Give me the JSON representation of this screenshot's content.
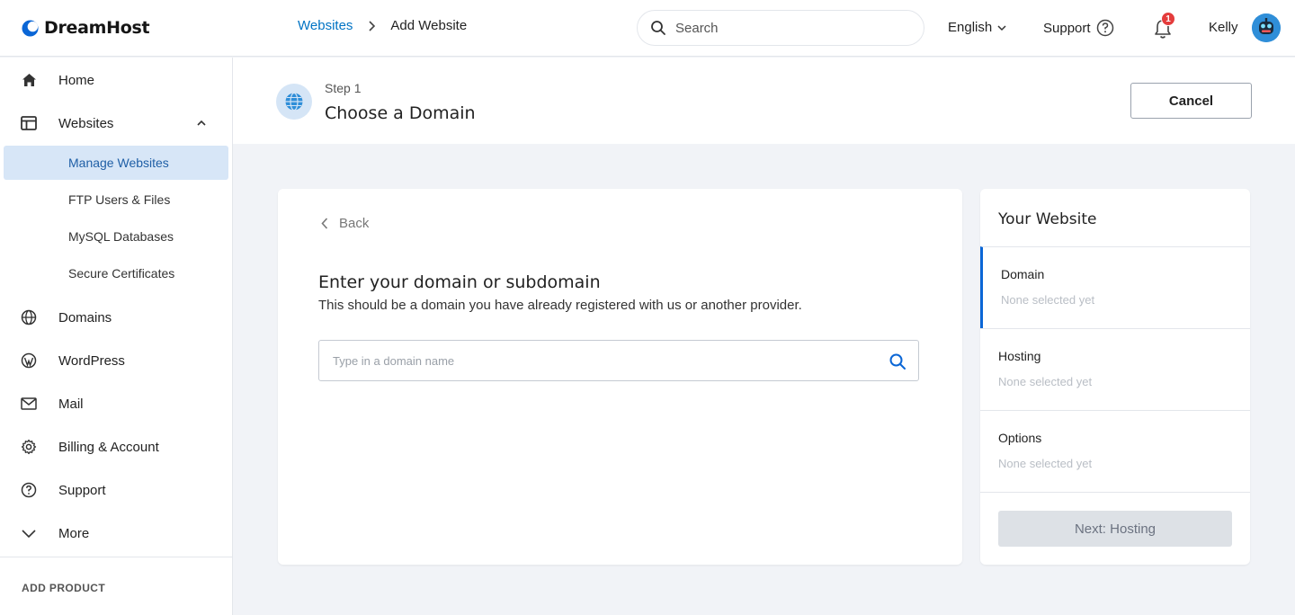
{
  "brand": {
    "name": "DreamHost",
    "accent": "#0073c4"
  },
  "breadcrumb": {
    "parent": "Websites",
    "current": "Add Website"
  },
  "search": {
    "placeholder": "Search",
    "value": ""
  },
  "language": {
    "label": "English"
  },
  "support": {
    "label": "Support"
  },
  "notifications": {
    "count": "1"
  },
  "user": {
    "name": "Kelly"
  },
  "sidebar": {
    "items": [
      {
        "label": "Home",
        "icon": "home-icon"
      },
      {
        "label": "Websites",
        "icon": "websites-icon",
        "expanded": true
      },
      {
        "label": "Domains",
        "icon": "globe-icon"
      },
      {
        "label": "WordPress",
        "icon": "wordpress-icon"
      },
      {
        "label": "Mail",
        "icon": "mail-icon"
      },
      {
        "label": "Billing & Account",
        "icon": "gear-icon"
      },
      {
        "label": "Support",
        "icon": "help-icon"
      },
      {
        "label": "More",
        "icon": "chevron-down-icon"
      }
    ],
    "websites_sub": [
      {
        "label": "Manage Websites",
        "active": true
      },
      {
        "label": "FTP Users & Files"
      },
      {
        "label": "MySQL Databases"
      },
      {
        "label": "Secure Certificates"
      }
    ],
    "add_product": "ADD PRODUCT"
  },
  "step": {
    "number": "Step 1",
    "title": "Choose a Domain",
    "cancel_label": "Cancel"
  },
  "main": {
    "back_label": "Back",
    "title": "Enter your domain or subdomain",
    "description": "This should be a domain you have already registered with us or another provider.",
    "domain_input": {
      "placeholder": "Type in a domain name",
      "value": ""
    }
  },
  "summary": {
    "title": "Your Website",
    "rows": [
      {
        "label": "Domain",
        "value": "None selected yet",
        "active": true
      },
      {
        "label": "Hosting",
        "value": "None selected yet"
      },
      {
        "label": "Options",
        "value": "None selected yet"
      }
    ],
    "next_label": "Next: Hosting"
  }
}
